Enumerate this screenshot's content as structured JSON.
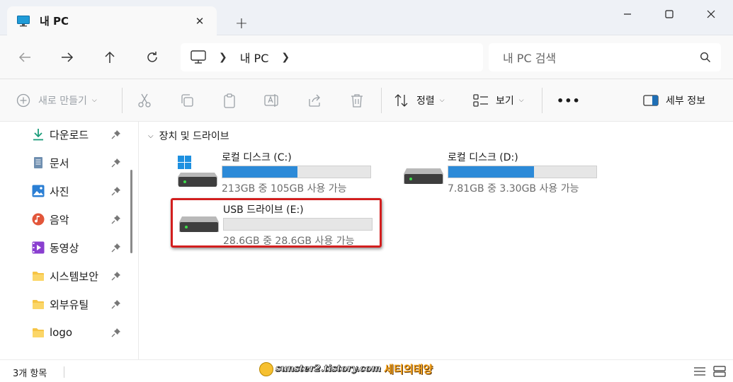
{
  "window": {
    "tab_title": "내 PC",
    "tab_close_glyph": "✕",
    "new_tab_glyph": "+"
  },
  "address_bar": {
    "location": "내 PC",
    "search_placeholder": "내 PC 검색"
  },
  "commands": {
    "new_label": "새로 만들기",
    "sort_label": "정렬",
    "view_label": "보기",
    "more_label": "•••",
    "details_label": "세부 정보"
  },
  "sidebar": {
    "items": [
      {
        "label": "다운로드",
        "icon": "download-icon"
      },
      {
        "label": "문서",
        "icon": "document-icon"
      },
      {
        "label": "사진",
        "icon": "pictures-icon"
      },
      {
        "label": "음악",
        "icon": "music-icon"
      },
      {
        "label": "동영상",
        "icon": "video-icon"
      },
      {
        "label": "시스템보안",
        "icon": "folder-icon"
      },
      {
        "label": "외부유틸",
        "icon": "folder-icon"
      },
      {
        "label": "logo",
        "icon": "folder-icon"
      }
    ]
  },
  "content": {
    "group_title": "장치 및 드라이브",
    "drives": [
      {
        "name": "로컬 디스크 (C:)",
        "info": "213GB 중 105GB 사용 가능",
        "used_fraction": 0.507,
        "icon": "windows-drive-icon"
      },
      {
        "name": "로컬 디스크 (D:)",
        "info": "7.81GB 중 3.30GB 사용 가능",
        "used_fraction": 0.577,
        "icon": "hard-drive-icon"
      },
      {
        "name": "USB 드라이브 (E:)",
        "info": "28.6GB 중 28.6GB 사용 가능",
        "used_fraction": 0.0,
        "icon": "usb-drive-icon"
      }
    ]
  },
  "status": {
    "item_count": "3개 항목",
    "watermark_url": "sunster2.tistory.com",
    "watermark_name": "세티의태양"
  },
  "colors": {
    "accent": "#2c8ad8",
    "highlight": "#d21e1e"
  }
}
